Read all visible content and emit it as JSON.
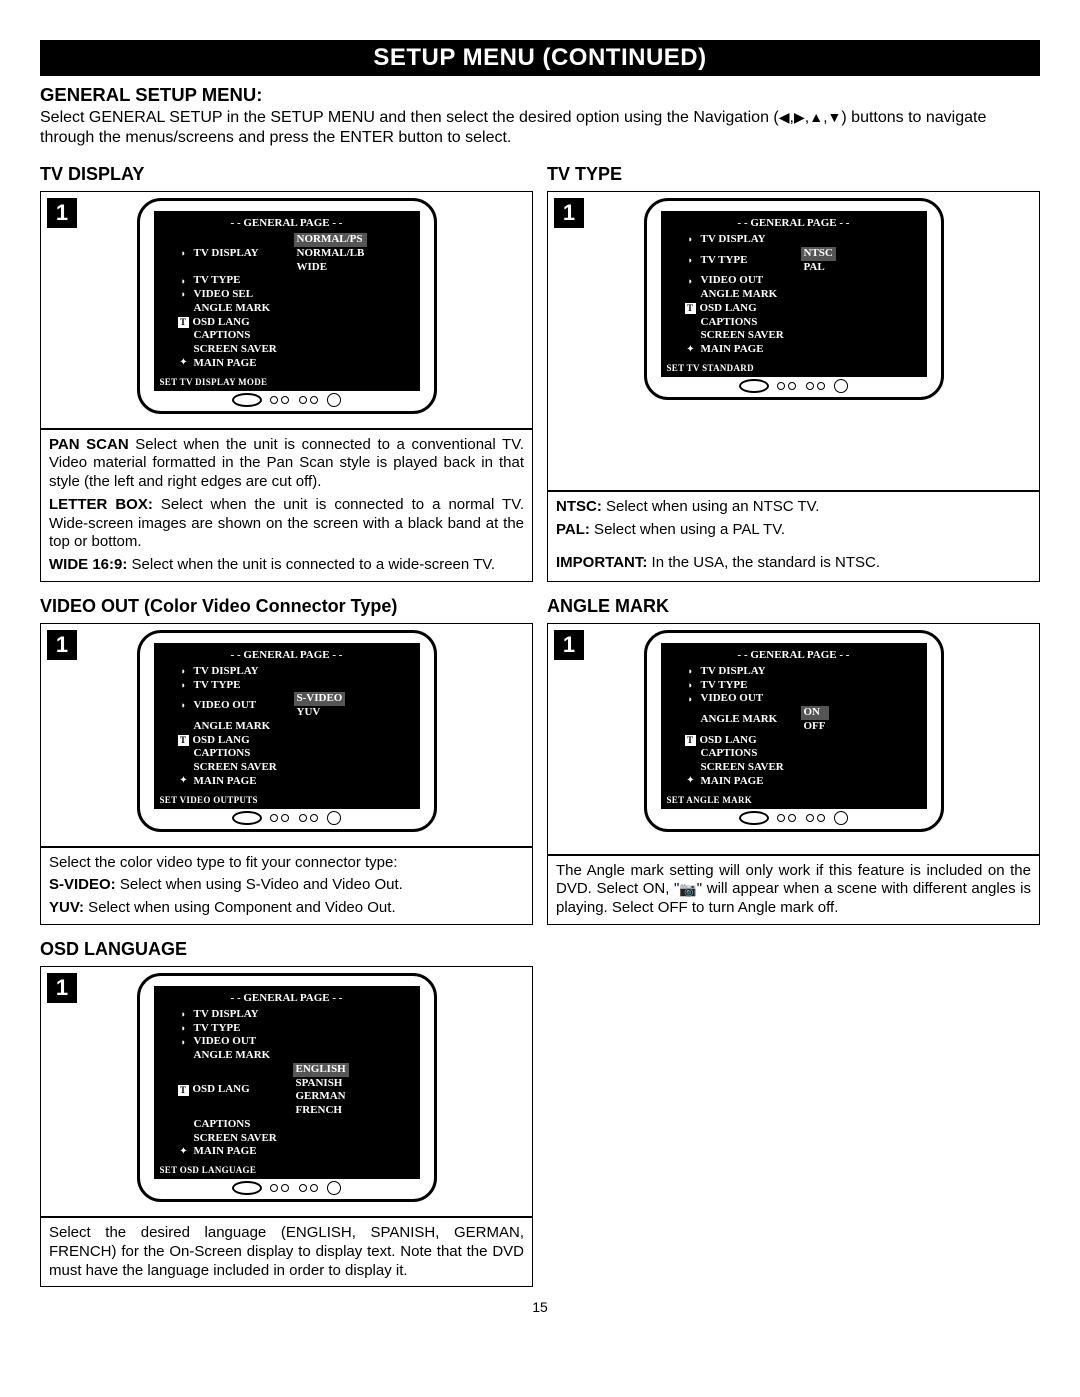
{
  "page_title": "SETUP MENU (CONTINUED)",
  "general_setup": {
    "heading": "GENERAL SETUP MENU:",
    "intro_pre": "Select GENERAL SETUP in the SETUP MENU and then select the desired option using the Navigation (",
    "intro_post": ") buttons to navigate through the menus/screens and press the ENTER button to select."
  },
  "sections": {
    "tv_display": {
      "heading": "TV DISPLAY",
      "step": "1",
      "screen": {
        "title": "- - GENERAL PAGE - -",
        "items": [
          {
            "icon": "flag",
            "label": "TV DISPLAY",
            "opts": [
              "NORMAL/PS",
              "NORMAL/LB",
              "WIDE"
            ],
            "sel": 0
          },
          {
            "icon": "flag",
            "label": "TV TYPE"
          },
          {
            "icon": "flag",
            "label": "VIDEO SEL"
          },
          {
            "icon": "none",
            "label": "ANGLE MARK"
          },
          {
            "icon": "T",
            "label": "OSD LANG"
          },
          {
            "icon": "none",
            "label": "CAPTIONS"
          },
          {
            "icon": "none",
            "label": "SCREEN SAVER"
          },
          {
            "icon": "aleft",
            "label": "MAIN PAGE"
          }
        ],
        "footer": "SET TV DISPLAY MODE"
      },
      "desc": {
        "p1_label": "PAN SCAN",
        "p1_rest": " Select when the unit is connected to a conventional TV. Video material formatted in the Pan Scan style is played back in that style (the left and right edges are cut off).",
        "p2_label": "LETTER BOX:",
        "p2_rest": " Select when the unit is connected to a normal TV. Wide-screen images are shown on the screen with a black band at the top or bottom.",
        "p3_label": "WIDE 16:9:",
        "p3_rest": " Select when the unit is connected to a wide-screen TV."
      }
    },
    "tv_type": {
      "heading": "TV TYPE",
      "step": "1",
      "screen": {
        "title": "- - GENERAL PAGE - -",
        "items": [
          {
            "icon": "flag",
            "label": "TV DISPLAY"
          },
          {
            "icon": "flag",
            "label": "TV TYPE",
            "opts": [
              "NTSC",
              "PAL"
            ],
            "sel": 0
          },
          {
            "icon": "flag",
            "label": "VIDEO OUT"
          },
          {
            "icon": "none",
            "label": "ANGLE MARK"
          },
          {
            "icon": "T",
            "label": "OSD LANG"
          },
          {
            "icon": "none",
            "label": "CAPTIONS"
          },
          {
            "icon": "none",
            "label": "SCREEN SAVER"
          },
          {
            "icon": "aleft",
            "label": "MAIN PAGE"
          }
        ],
        "footer": "SET TV STANDARD"
      },
      "desc": {
        "p1_label": "NTSC:",
        "p1_rest": " Select when using an NTSC TV.",
        "p2_label": "PAL:",
        "p2_rest": " Select when using a PAL TV.",
        "p3_label": "IMPORTANT:",
        "p3_rest": " In the USA, the standard is NTSC."
      }
    },
    "video_out": {
      "heading": "VIDEO OUT (Color Video Connector Type)",
      "step": "1",
      "screen": {
        "title": "- - GENERAL PAGE - -",
        "items": [
          {
            "icon": "flag",
            "label": "TV DISPLAY"
          },
          {
            "icon": "flag",
            "label": "TV TYPE"
          },
          {
            "icon": "flag",
            "label": "VIDEO OUT",
            "opts": [
              "S-VIDEO",
              "YUV"
            ],
            "sel": 0
          },
          {
            "icon": "none",
            "label": "ANGLE MARK"
          },
          {
            "icon": "T",
            "label": "OSD LANG"
          },
          {
            "icon": "none",
            "label": "CAPTIONS"
          },
          {
            "icon": "none",
            "label": "SCREEN SAVER"
          },
          {
            "icon": "aleft",
            "label": "MAIN PAGE"
          }
        ],
        "footer": "SET VIDEO OUTPUTS"
      },
      "desc": {
        "p1": "Select the color video type to fit your connector type:",
        "p2_label": "S-VIDEO:",
        "p2_rest": "  Select when using S-Video and Video Out.",
        "p3_label": "YUV:",
        "p3_rest": " Select when using Component and Video Out."
      }
    },
    "angle_mark": {
      "heading": "ANGLE MARK",
      "step": "1",
      "screen": {
        "title": "- - GENERAL PAGE - -",
        "items": [
          {
            "icon": "flag",
            "label": "TV DISPLAY"
          },
          {
            "icon": "flag",
            "label": "TV TYPE"
          },
          {
            "icon": "flag",
            "label": "VIDEO OUT"
          },
          {
            "icon": "none",
            "label": "ANGLE MARK",
            "opts": [
              "ON",
              "OFF"
            ],
            "sel": 0
          },
          {
            "icon": "T",
            "label": "OSD LANG"
          },
          {
            "icon": "none",
            "label": "CAPTIONS"
          },
          {
            "icon": "none",
            "label": "SCREEN SAVER"
          },
          {
            "icon": "aleft",
            "label": "MAIN PAGE"
          }
        ],
        "footer": "SET ANGLE MARK"
      },
      "desc": {
        "p1_pre": "The Angle mark setting will only work if this feature is included on the DVD. Select ON,  \"",
        "p1_post": "\" will appear when a scene with different angles is playing. Select OFF to turn Angle mark off."
      }
    },
    "osd_lang": {
      "heading": "OSD LANGUAGE",
      "step": "1",
      "screen": {
        "title": "- - GENERAL PAGE - -",
        "items": [
          {
            "icon": "flag",
            "label": "TV DISPLAY"
          },
          {
            "icon": "flag",
            "label": "TV TYPE"
          },
          {
            "icon": "flag",
            "label": "VIDEO OUT"
          },
          {
            "icon": "none",
            "label": "ANGLE MARK"
          },
          {
            "icon": "T",
            "label": "OSD LANG",
            "opts": [
              "ENGLISH",
              "SPANISH",
              "GERMAN",
              "FRENCH"
            ],
            "sel": 0
          },
          {
            "icon": "none",
            "label": "CAPTIONS"
          },
          {
            "icon": "none",
            "label": "SCREEN SAVER"
          },
          {
            "icon": "aleft",
            "label": "MAIN PAGE"
          }
        ],
        "footer": "SET OSD LANGUAGE"
      },
      "desc": {
        "p1": "Select the desired language (ENGLISH, SPANISH, GERMAN, FRENCH) for the On-Screen display to display text. Note that the DVD must have the language included in order to display it."
      }
    }
  },
  "page_number": "15"
}
